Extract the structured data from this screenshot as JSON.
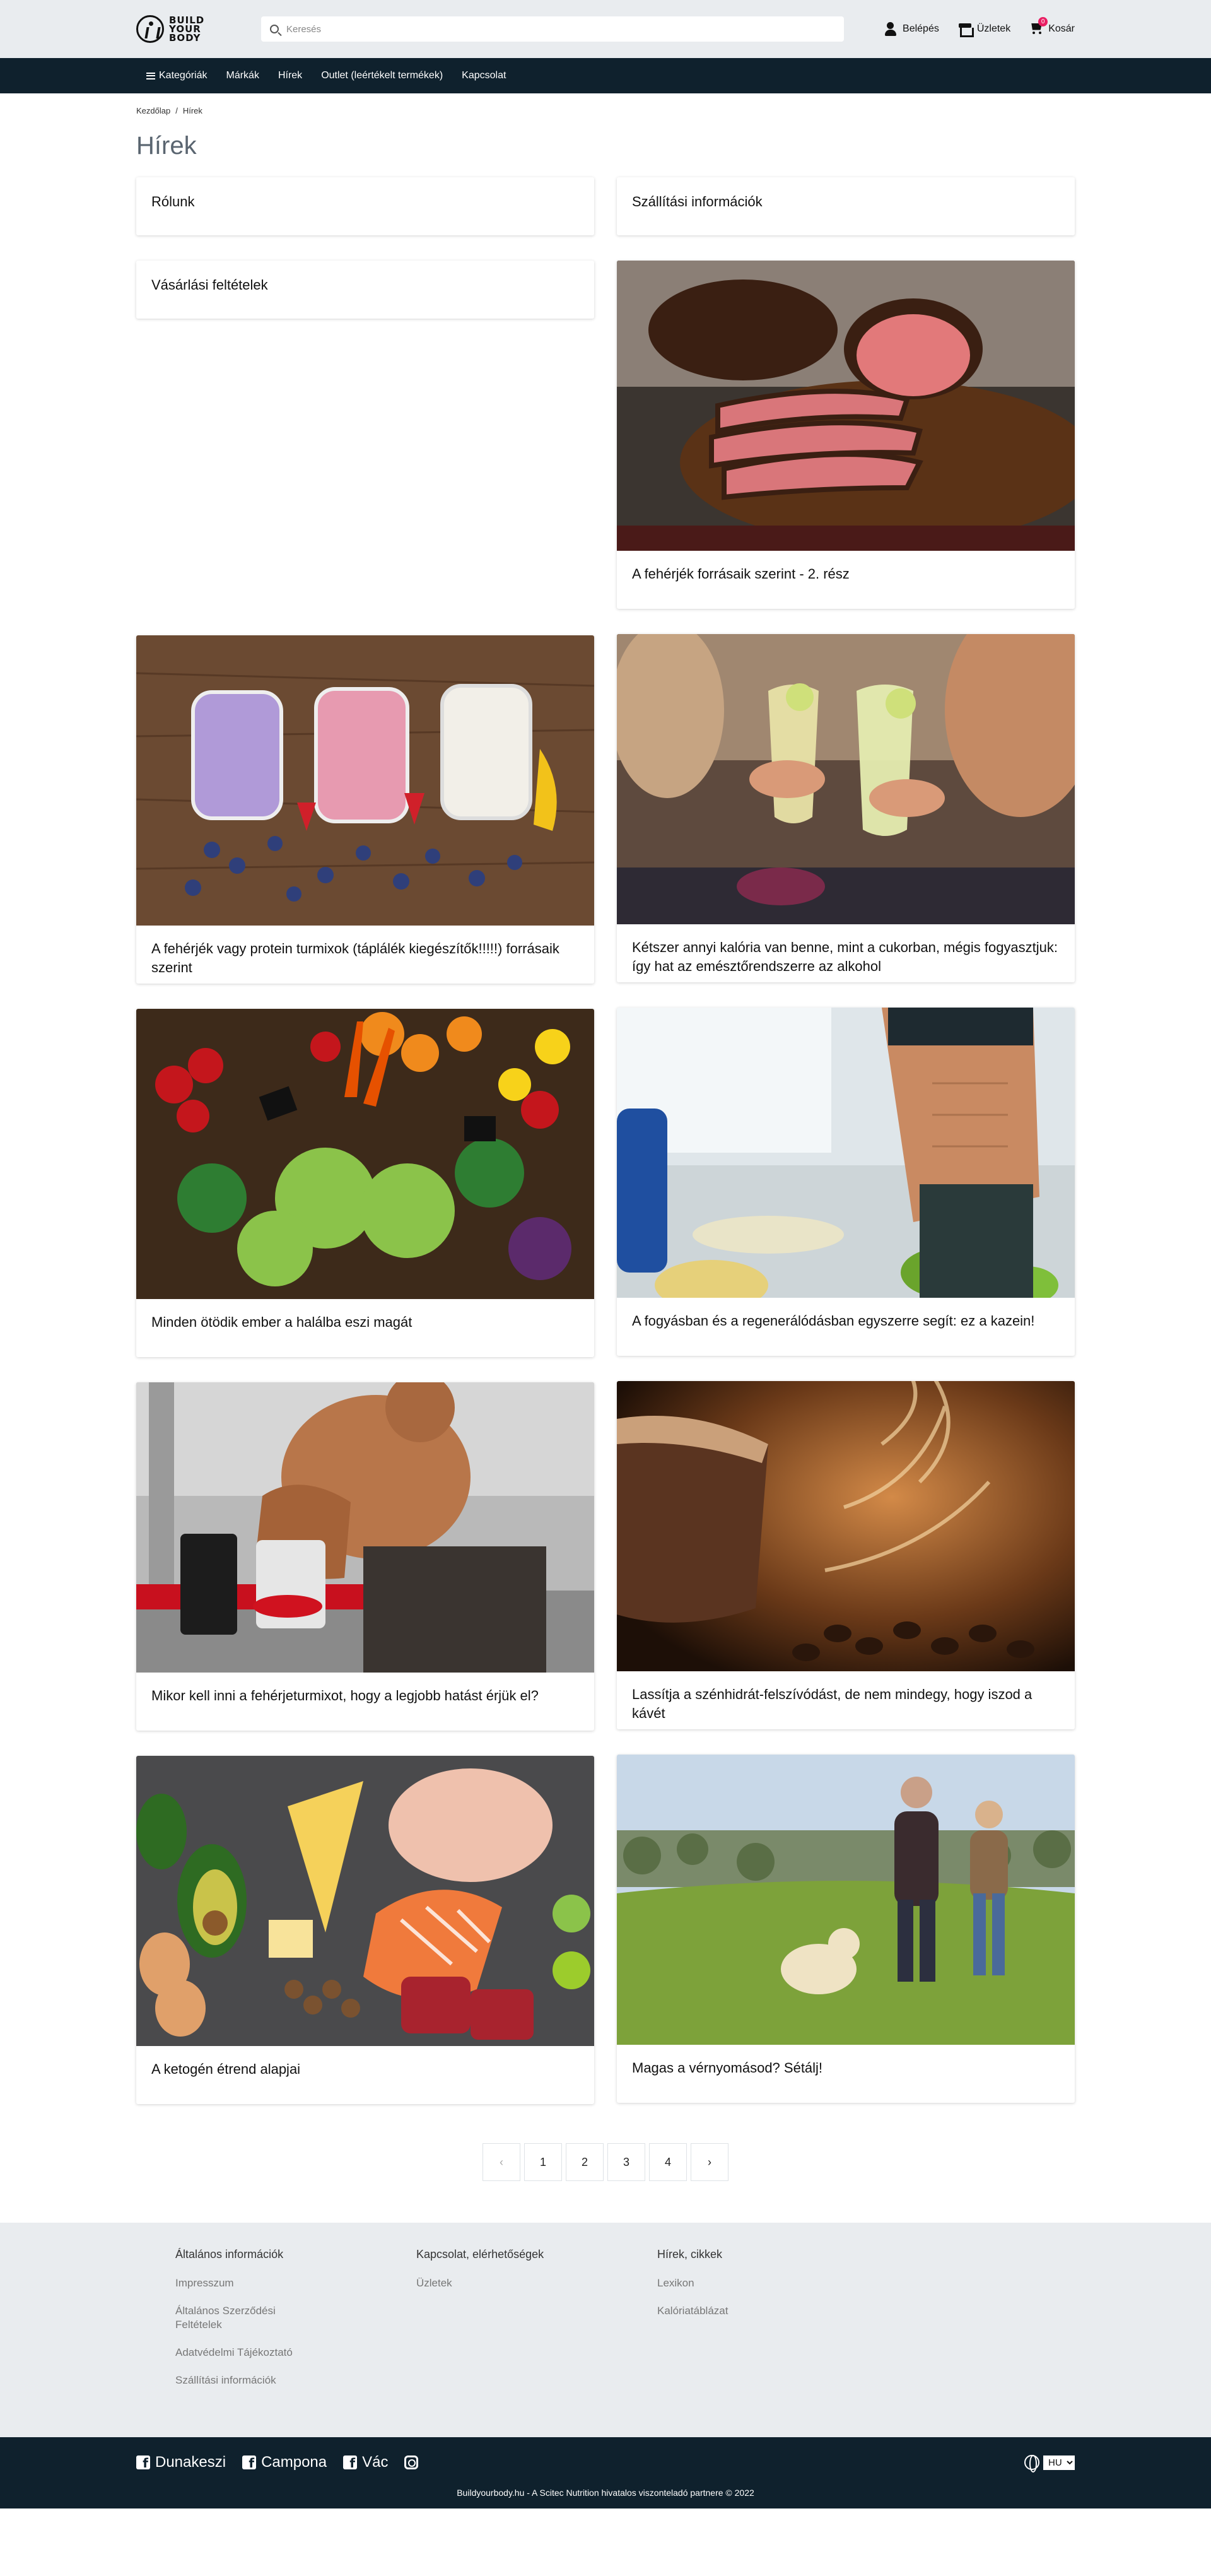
{
  "header": {
    "logo_text": "BUILD YOUR BODY",
    "search_placeholder": "Keresés",
    "login_label": "Belépés",
    "stores_label": "Üzletek",
    "cart_label": "Kosár",
    "cart_count": "0"
  },
  "nav": {
    "items": [
      "Kategóriák",
      "Márkák",
      "Hírek",
      "Outlet (leértékelt termékek)",
      "Kapcsolat"
    ]
  },
  "breadcrumb": [
    "Kezdőlap",
    "Hírek"
  ],
  "page_title": "Hírek",
  "left_cards": [
    {
      "title": "Rólunk"
    },
    {
      "title": "Vásárlási feltételek"
    },
    {
      "title": "A fehérjék vagy protein turmixok (táplálék kiegészítők!!!!!) forrásaik szerint",
      "image": "smoothies"
    },
    {
      "title": "Minden ötödik ember a halálba eszi magát",
      "image": "vegetables"
    },
    {
      "title": "Mikor kell inni a fehérjeturmixot, hogy a legjobb hatást érjük el?",
      "image": "gym-shaker"
    },
    {
      "title": "A ketogén étrend alapjai",
      "image": "keto-food"
    }
  ],
  "right_cards": [
    {
      "title": "Szállítási információk"
    },
    {
      "title": "A fehérjék forrásaik szerint - 2. rész",
      "image": "roast-beef"
    },
    {
      "title": "Kétszer annyi kalória van benne, mint a cukorban, mégis fogyasztjuk: így hat az emésztőrendszerre az alkohol",
      "image": "cocktails"
    },
    {
      "title": "A fogyásban és a regenerálódásban egyszerre segít: ez a kazein!",
      "image": "fitness-kitchen"
    },
    {
      "title": "Lassítja a szénhidrát-felszívódást, de nem mindegy, hogy iszod a kávét",
      "image": "coffee"
    },
    {
      "title": "Magas a vérnyomásod? Sétálj!",
      "image": "walking-couple"
    }
  ],
  "pagination": {
    "prev": "‹",
    "pages": [
      "1",
      "2",
      "3",
      "4"
    ],
    "next": "›"
  },
  "footer": {
    "col1_title": "Általános információk",
    "col1_links": [
      "Impresszum",
      "Általános Szerződési Feltételek",
      "Adatvédelmi Tájékoztató",
      "Szállítási információk"
    ],
    "col2_title": "Kapcsolat, elérhetőségek",
    "col2_links": [
      "Üzletek"
    ],
    "col3_title": "Hírek, cikkek",
    "col3_links": [
      "Lexikon",
      "Kalóriatáblázat"
    ]
  },
  "bottom": {
    "social": [
      "Dunakeszi",
      "Campona",
      "Vác"
    ],
    "language": "HU",
    "copyright": "Buildyourbody.hu - A Scitec Nutrition hivatalos viszonteladó partnere © 2022"
  },
  "colors": {
    "header_bg": "#e9ecef",
    "nav_bg": "#0f212d",
    "badge": "#e91e63"
  }
}
